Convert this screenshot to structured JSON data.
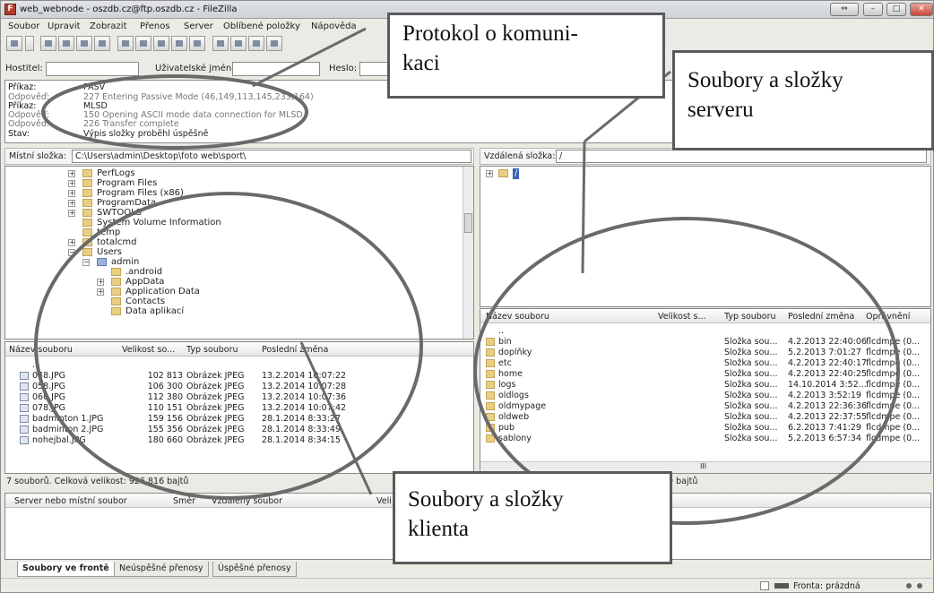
{
  "window": {
    "title": "web_webnode - oszdb.cz@ftp.oszdb.cz - FileZilla",
    "app_icon_letter": "F"
  },
  "menu": [
    "Soubor",
    "Upravit",
    "Zobrazit",
    "Přenos",
    "Server",
    "Oblíbené položky",
    "Nápověda"
  ],
  "quickconnect": {
    "host_label": "Hostitel:",
    "user_label": "Uživatelské jméno:",
    "pass_label": "Heslo:"
  },
  "log": [
    {
      "key": "Příkaz:",
      "value": "PASV"
    },
    {
      "key": "Odpověď:",
      "value": "227 Entering Passive Mode (46,149,113,145,233,164)"
    },
    {
      "key": "Příkaz:",
      "value": "MLSD"
    },
    {
      "key": "Odpověď:",
      "value": "150 Opening ASCII mode data connection for MLSD"
    },
    {
      "key": "Odpověď:",
      "value": "226 Transfer complete"
    },
    {
      "key": "Stav:",
      "value": "Výpis složky proběhl úspěšně"
    }
  ],
  "local": {
    "path_label": "Místní složka:",
    "path_value": "C:\\Users\\admin\\Desktop\\foto web\\sport\\",
    "tree": [
      {
        "label": "PerfLogs"
      },
      {
        "label": "Program Files"
      },
      {
        "label": "Program Files (x86)"
      },
      {
        "label": "ProgramData"
      },
      {
        "label": "SWTOOLS"
      },
      {
        "label": "System Volume Information"
      },
      {
        "label": "temp"
      },
      {
        "label": "totalcmd"
      },
      {
        "label": "Users"
      },
      {
        "label": "admin"
      },
      {
        "label": ".android"
      },
      {
        "label": "AppData"
      },
      {
        "label": "Application Data"
      },
      {
        "label": "Contacts"
      },
      {
        "label": "Data aplikací"
      }
    ],
    "columns": [
      "Název souboru",
      "Velikost so...",
      "Typ souboru",
      "Poslední změna"
    ],
    "files": [
      {
        "name": "..",
        "size": "",
        "type": "",
        "modified": ""
      },
      {
        "name": "048.JPG",
        "size": "102 813",
        "type": "Obrázek JPEG",
        "modified": "13.2.2014 10:07:22"
      },
      {
        "name": "058.JPG",
        "size": "106 300",
        "type": "Obrázek JPEG",
        "modified": "13.2.2014 10:07:28"
      },
      {
        "name": "060.JPG",
        "size": "112 380",
        "type": "Obrázek JPEG",
        "modified": "13.2.2014 10:07:36"
      },
      {
        "name": "078.JPG",
        "size": "110 151",
        "type": "Obrázek JPEG",
        "modified": "13.2.2014 10:07:42"
      },
      {
        "name": "badminton 1.JPG",
        "size": "159 156",
        "type": "Obrázek JPEG",
        "modified": "28.1.2014 8:33:27"
      },
      {
        "name": "badminton 2.JPG",
        "size": "155 356",
        "type": "Obrázek JPEG",
        "modified": "28.1.2014 8:33:49"
      },
      {
        "name": "nohejbal.JPG",
        "size": "180 660",
        "type": "Obrázek JPEG",
        "modified": "28.1.2014 8:34:15"
      }
    ],
    "status": "7 souborů. Celková velikost: 926 816 bajtů"
  },
  "remote": {
    "path_label": "Vzdálená složka:",
    "path_value": "/",
    "tree_root": "/",
    "columns": [
      "Název souboru",
      "Velikost s...",
      "Typ souboru",
      "Poslední změna",
      "Oprávnění"
    ],
    "files": [
      {
        "name": "..",
        "type": "",
        "modified": "",
        "perms": ""
      },
      {
        "name": "bin",
        "type": "Složka sou...",
        "modified": "4.2.2013 22:40:06",
        "perms": "flcdmpe (0..."
      },
      {
        "name": "doplňky",
        "type": "Složka sou...",
        "modified": "5.2.2013 7:01:27",
        "perms": "flcdmpe (0..."
      },
      {
        "name": "etc",
        "type": "Složka sou...",
        "modified": "4.2.2013 22:40:17",
        "perms": "flcdmpe (0..."
      },
      {
        "name": "home",
        "type": "Složka sou...",
        "modified": "4.2.2013 22:40:25",
        "perms": "flcdmpe (0..."
      },
      {
        "name": "logs",
        "type": "Složka sou...",
        "modified": "14.10.2014 3:52...",
        "perms": "flcdmpe (0..."
      },
      {
        "name": "oldlogs",
        "type": "Složka sou...",
        "modified": "4.2.2013 3:52:19",
        "perms": "flcdmpe (0..."
      },
      {
        "name": "oldmypage",
        "type": "Složka sou...",
        "modified": "4.2.2013 22:36:36",
        "perms": "flcdmpe (0..."
      },
      {
        "name": "oldweb",
        "type": "Složka sou...",
        "modified": "4.2.2013 22:37:55",
        "perms": "flcdmpe (0..."
      },
      {
        "name": "pub",
        "type": "Složka sou...",
        "modified": "6.2.2013 7:41:29",
        "perms": "flcdmpe (0..."
      },
      {
        "name": "sablony",
        "type": "Složka sou...",
        "modified": "5.2.2013 6:57:34",
        "perms": "flcdmpe (0..."
      }
    ],
    "status_tail": "79 bajtů",
    "scroll_label": "III"
  },
  "queue": {
    "columns": [
      "Server nebo místní soubor",
      "Směr",
      "Vzdálený soubor",
      "Veli"
    ],
    "tabs": [
      "Soubory ve frontě",
      "Neúspěšné přenosy",
      "Úspěšné přenosy"
    ],
    "status": "Fronta: prázdná"
  },
  "callouts": {
    "log": "Protokol o komuni-\nkaci",
    "server": "Soubory a složky\nserveru",
    "client": "Soubory a složky\nklienta"
  }
}
